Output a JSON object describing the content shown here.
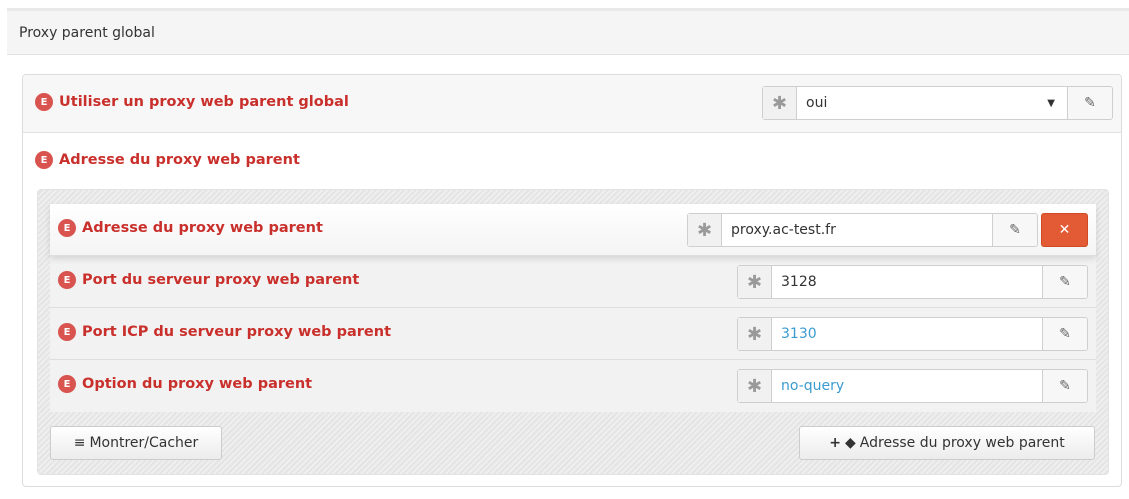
{
  "section": {
    "title": "Proxy parent global"
  },
  "badge": "E",
  "global_proxy": {
    "label": "Utiliser un proxy web parent global",
    "value": "oui",
    "required_icon": "asterisk-icon",
    "edit_icon": "edit-icon"
  },
  "group": {
    "label": "Adresse du proxy web parent",
    "fields": [
      {
        "label": "Adresse du proxy web parent",
        "value": "proxy.ac-test.fr"
      },
      {
        "label": "Port du serveur proxy web parent",
        "value": "3128"
      },
      {
        "label": "Port ICP du serveur proxy web parent",
        "value": "3130"
      },
      {
        "label": "Option du proxy web parent",
        "value": "no-query"
      }
    ],
    "toggle_button": "Montrer/Cacher",
    "add_button": "Adresse du proxy web parent"
  },
  "colors": {
    "label": "#c9302c",
    "badge": "#d9534f",
    "delete": "#e35b34",
    "default_value": "#3a9bd0"
  }
}
